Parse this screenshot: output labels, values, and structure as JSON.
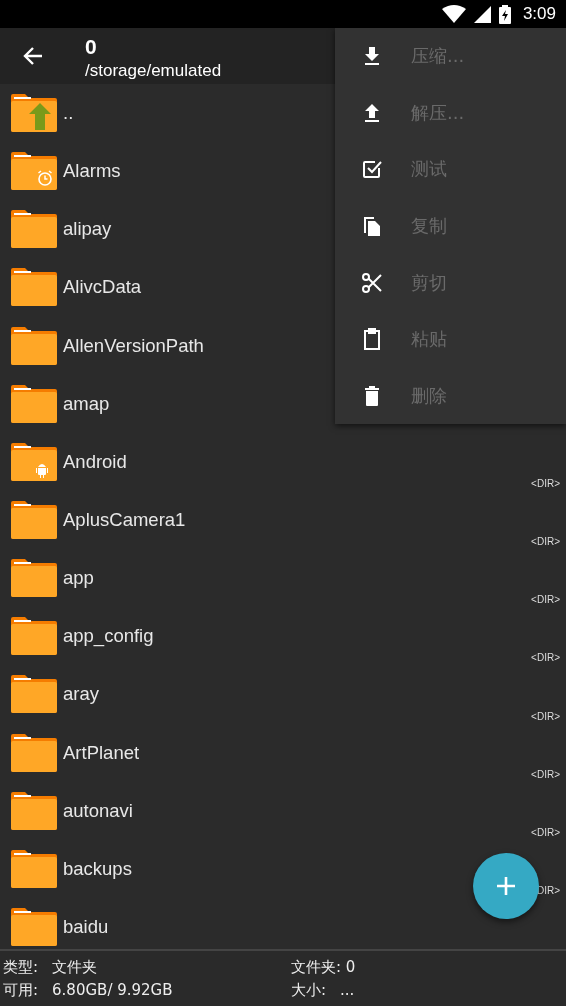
{
  "status_bar": {
    "time": "3:09"
  },
  "toolbar": {
    "title": "0",
    "path": "/storage/emulated"
  },
  "files": [
    {
      "name": "..",
      "kind": "up"
    },
    {
      "name": "Alarms",
      "kind": "alarm"
    },
    {
      "name": "alipay",
      "kind": "plain"
    },
    {
      "name": "AlivcData",
      "kind": "plain"
    },
    {
      "name": "AllenVersionPath",
      "kind": "plain"
    },
    {
      "name": "amap",
      "kind": "plain"
    },
    {
      "name": "Android",
      "kind": "android",
      "tag": "<DIR>"
    },
    {
      "name": "AplusCamera1",
      "kind": "plain",
      "tag": "<DIR>"
    },
    {
      "name": "app",
      "kind": "plain",
      "tag": "<DIR>"
    },
    {
      "name": "app_config",
      "kind": "plain",
      "tag": "<DIR>"
    },
    {
      "name": "aray",
      "kind": "plain",
      "tag": "<DIR>"
    },
    {
      "name": "ArtPlanet",
      "kind": "plain",
      "tag": "<DIR>"
    },
    {
      "name": "autonavi",
      "kind": "plain",
      "tag": "<DIR>"
    },
    {
      "name": "backups",
      "kind": "plain",
      "tag": "DIR>"
    },
    {
      "name": "baidu",
      "kind": "plain"
    }
  ],
  "menu": [
    {
      "label": "压缩...",
      "kind": "compress",
      "disabled": true
    },
    {
      "label": "解压...",
      "kind": "extract",
      "disabled": true
    },
    {
      "label": "测试",
      "kind": "test",
      "disabled": true
    },
    {
      "label": "复制",
      "kind": "copy",
      "disabled": true
    },
    {
      "label": "剪切",
      "kind": "cut",
      "disabled": true
    },
    {
      "label": "粘贴",
      "kind": "paste",
      "disabled": true
    },
    {
      "label": "删除",
      "kind": "delete",
      "disabled": true
    }
  ],
  "info": {
    "type_label": "类型:",
    "type_value": "文件夹",
    "folders": "文件夹: 0",
    "free_label": "可用:",
    "free_value": "6.80GB/ 9.92GB",
    "size_label": "大小:",
    "size_value": "..."
  }
}
